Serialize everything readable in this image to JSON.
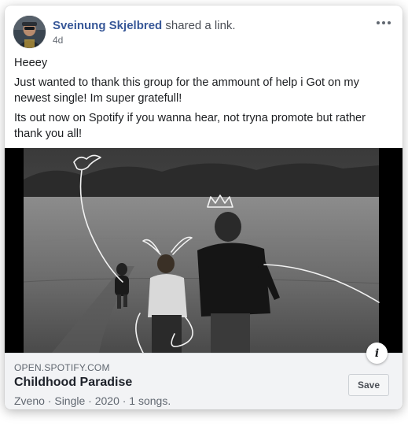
{
  "post": {
    "author": "Sveinung Skjelbred",
    "action": " shared a link.",
    "timestamp": "4d",
    "more_icon": "more-horizontal-icon",
    "paragraphs": [
      "Heeey",
      "Just wanted to thank this group for the ammount of help i Got on my newest single! Im super gratefull!",
      "Its out now on Spotify if you wanna hear, not tryna promote but rather thank you all!"
    ]
  },
  "link": {
    "domain": "OPEN.SPOTIFY.COM",
    "title": "Childhood Paradise",
    "description": "Zveno · Single · 2020 · 1 songs.",
    "save_label": "Save",
    "info_icon": "info-icon",
    "info_glyph": "i"
  },
  "colors": {
    "author_link": "#385898",
    "meta_background": "#f2f3f5",
    "text_primary": "#1c1e21",
    "text_secondary": "#606770"
  }
}
